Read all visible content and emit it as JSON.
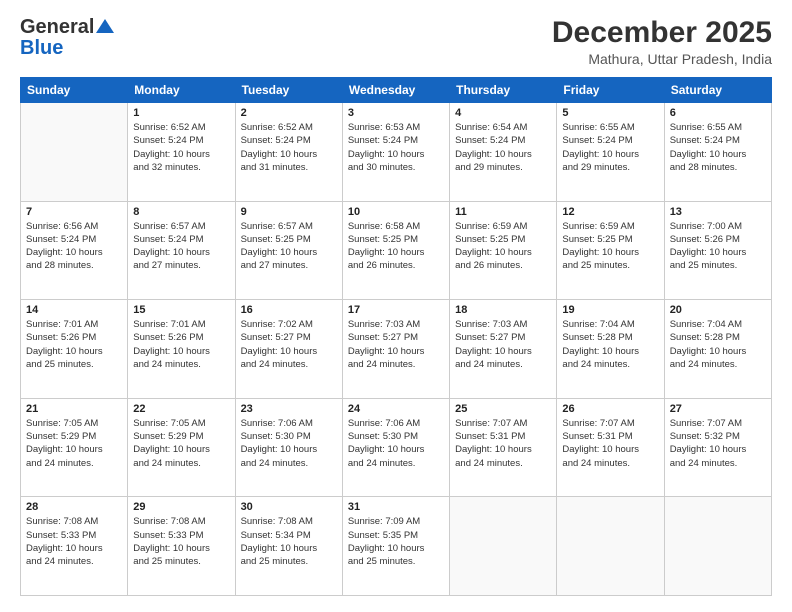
{
  "header": {
    "logo": {
      "line1": "General",
      "line2": "Blue"
    },
    "title": "December 2025",
    "location": "Mathura, Uttar Pradesh, India"
  },
  "weekdays": [
    "Sunday",
    "Monday",
    "Tuesday",
    "Wednesday",
    "Thursday",
    "Friday",
    "Saturday"
  ],
  "weeks": [
    [
      {
        "day": "",
        "info": ""
      },
      {
        "day": "1",
        "info": "Sunrise: 6:52 AM\nSunset: 5:24 PM\nDaylight: 10 hours\nand 32 minutes."
      },
      {
        "day": "2",
        "info": "Sunrise: 6:52 AM\nSunset: 5:24 PM\nDaylight: 10 hours\nand 31 minutes."
      },
      {
        "day": "3",
        "info": "Sunrise: 6:53 AM\nSunset: 5:24 PM\nDaylight: 10 hours\nand 30 minutes."
      },
      {
        "day": "4",
        "info": "Sunrise: 6:54 AM\nSunset: 5:24 PM\nDaylight: 10 hours\nand 29 minutes."
      },
      {
        "day": "5",
        "info": "Sunrise: 6:55 AM\nSunset: 5:24 PM\nDaylight: 10 hours\nand 29 minutes."
      },
      {
        "day": "6",
        "info": "Sunrise: 6:55 AM\nSunset: 5:24 PM\nDaylight: 10 hours\nand 28 minutes."
      }
    ],
    [
      {
        "day": "7",
        "info": "Sunrise: 6:56 AM\nSunset: 5:24 PM\nDaylight: 10 hours\nand 28 minutes."
      },
      {
        "day": "8",
        "info": "Sunrise: 6:57 AM\nSunset: 5:24 PM\nDaylight: 10 hours\nand 27 minutes."
      },
      {
        "day": "9",
        "info": "Sunrise: 6:57 AM\nSunset: 5:25 PM\nDaylight: 10 hours\nand 27 minutes."
      },
      {
        "day": "10",
        "info": "Sunrise: 6:58 AM\nSunset: 5:25 PM\nDaylight: 10 hours\nand 26 minutes."
      },
      {
        "day": "11",
        "info": "Sunrise: 6:59 AM\nSunset: 5:25 PM\nDaylight: 10 hours\nand 26 minutes."
      },
      {
        "day": "12",
        "info": "Sunrise: 6:59 AM\nSunset: 5:25 PM\nDaylight: 10 hours\nand 25 minutes."
      },
      {
        "day": "13",
        "info": "Sunrise: 7:00 AM\nSunset: 5:26 PM\nDaylight: 10 hours\nand 25 minutes."
      }
    ],
    [
      {
        "day": "14",
        "info": "Sunrise: 7:01 AM\nSunset: 5:26 PM\nDaylight: 10 hours\nand 25 minutes."
      },
      {
        "day": "15",
        "info": "Sunrise: 7:01 AM\nSunset: 5:26 PM\nDaylight: 10 hours\nand 24 minutes."
      },
      {
        "day": "16",
        "info": "Sunrise: 7:02 AM\nSunset: 5:27 PM\nDaylight: 10 hours\nand 24 minutes."
      },
      {
        "day": "17",
        "info": "Sunrise: 7:03 AM\nSunset: 5:27 PM\nDaylight: 10 hours\nand 24 minutes."
      },
      {
        "day": "18",
        "info": "Sunrise: 7:03 AM\nSunset: 5:27 PM\nDaylight: 10 hours\nand 24 minutes."
      },
      {
        "day": "19",
        "info": "Sunrise: 7:04 AM\nSunset: 5:28 PM\nDaylight: 10 hours\nand 24 minutes."
      },
      {
        "day": "20",
        "info": "Sunrise: 7:04 AM\nSunset: 5:28 PM\nDaylight: 10 hours\nand 24 minutes."
      }
    ],
    [
      {
        "day": "21",
        "info": "Sunrise: 7:05 AM\nSunset: 5:29 PM\nDaylight: 10 hours\nand 24 minutes."
      },
      {
        "day": "22",
        "info": "Sunrise: 7:05 AM\nSunset: 5:29 PM\nDaylight: 10 hours\nand 24 minutes."
      },
      {
        "day": "23",
        "info": "Sunrise: 7:06 AM\nSunset: 5:30 PM\nDaylight: 10 hours\nand 24 minutes."
      },
      {
        "day": "24",
        "info": "Sunrise: 7:06 AM\nSunset: 5:30 PM\nDaylight: 10 hours\nand 24 minutes."
      },
      {
        "day": "25",
        "info": "Sunrise: 7:07 AM\nSunset: 5:31 PM\nDaylight: 10 hours\nand 24 minutes."
      },
      {
        "day": "26",
        "info": "Sunrise: 7:07 AM\nSunset: 5:31 PM\nDaylight: 10 hours\nand 24 minutes."
      },
      {
        "day": "27",
        "info": "Sunrise: 7:07 AM\nSunset: 5:32 PM\nDaylight: 10 hours\nand 24 minutes."
      }
    ],
    [
      {
        "day": "28",
        "info": "Sunrise: 7:08 AM\nSunset: 5:33 PM\nDaylight: 10 hours\nand 24 minutes."
      },
      {
        "day": "29",
        "info": "Sunrise: 7:08 AM\nSunset: 5:33 PM\nDaylight: 10 hours\nand 25 minutes."
      },
      {
        "day": "30",
        "info": "Sunrise: 7:08 AM\nSunset: 5:34 PM\nDaylight: 10 hours\nand 25 minutes."
      },
      {
        "day": "31",
        "info": "Sunrise: 7:09 AM\nSunset: 5:35 PM\nDaylight: 10 hours\nand 25 minutes."
      },
      {
        "day": "",
        "info": ""
      },
      {
        "day": "",
        "info": ""
      },
      {
        "day": "",
        "info": ""
      }
    ]
  ]
}
